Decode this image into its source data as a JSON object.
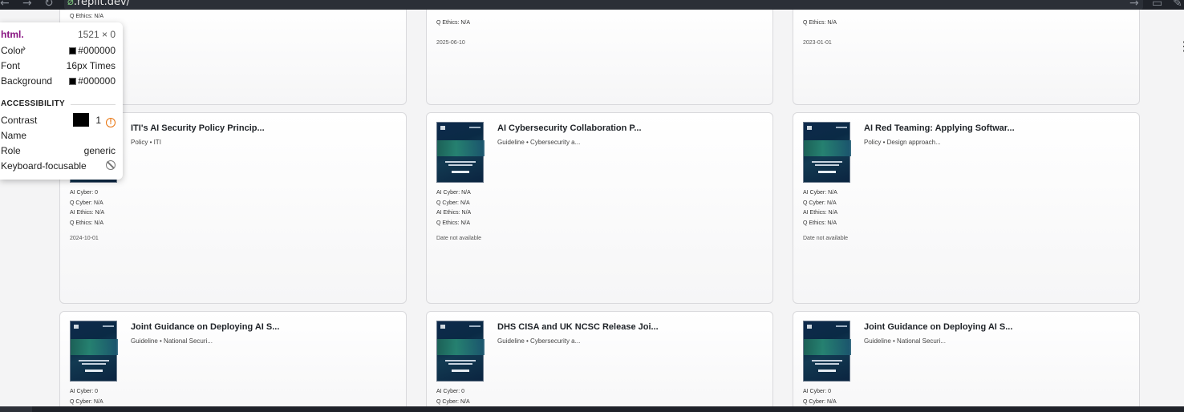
{
  "browser": {
    "url_prefix": "⌀",
    "url_host": ".replit.dev/"
  },
  "tooltip": {
    "tag": "html.",
    "size": "1521 × 0",
    "color_label": "Color",
    "color_value": "#000000",
    "font_label": "Font",
    "font_value": "16px Times",
    "background_label": "Background",
    "background_value": "#000000",
    "section_title": "ACCESSIBILITY",
    "contrast_label": "Contrast",
    "contrast_value": "1",
    "name_label": "Name",
    "role_label": "Role",
    "role_value": "generic",
    "keyboard_label": "Keyboard-focusable"
  },
  "top_cards": [
    {
      "q_ethics": "Q Ethics: N/A",
      "date": "",
      "partial": "Q Ethics: N/A"
    },
    {
      "q_ethics": "Q Ethics: N/A",
      "date": "2025-06-10"
    },
    {
      "q_ethics": "Q Ethics: N/A",
      "date": "2023-01-01"
    }
  ],
  "cards": [
    {
      "title": "ITI's AI Security Policy Princip...",
      "meta": "Policy • ITI",
      "ai_cyber": "AI Cyber: 0",
      "q_cyber": "Q Cyber: N/A",
      "ai_ethics": "AI Ethics: N/A",
      "q_ethics": "Q Ethics: N/A",
      "date": "2024-10-01"
    },
    {
      "title": "AI Cybersecurity Collaboration P...",
      "meta": "Guideline • Cybersecurity a...",
      "ai_cyber": "AI Cyber: N/A",
      "q_cyber": "Q Cyber: N/A",
      "ai_ethics": "AI Ethics: N/A",
      "q_ethics": "Q Ethics: N/A",
      "date": "Date not available"
    },
    {
      "title": "AI Red Teaming: Applying Softwar...",
      "meta": "Policy • Design approach...",
      "ai_cyber": "AI Cyber: N/A",
      "q_cyber": "Q Cyber: N/A",
      "ai_ethics": "AI Ethics: N/A",
      "q_ethics": "Q Ethics: N/A",
      "date": "Date not available"
    },
    {
      "title": "Joint Guidance on Deploying AI S...",
      "meta": "Guideline • National Securi...",
      "ai_cyber": "AI Cyber: 0",
      "q_cyber": "Q Cyber: N/A"
    },
    {
      "title": "DHS CISA and UK NCSC Release Joi...",
      "meta": "Guideline • Cybersecurity a...",
      "ai_cyber": "AI Cyber: 0",
      "q_cyber": "Q Cyber: N/A"
    },
    {
      "title": "Joint Guidance on Deploying AI S...",
      "meta": "Guideline • National Securi...",
      "ai_cyber": "AI Cyber: 0",
      "q_cyber": "Q Cyber: N/A"
    }
  ]
}
